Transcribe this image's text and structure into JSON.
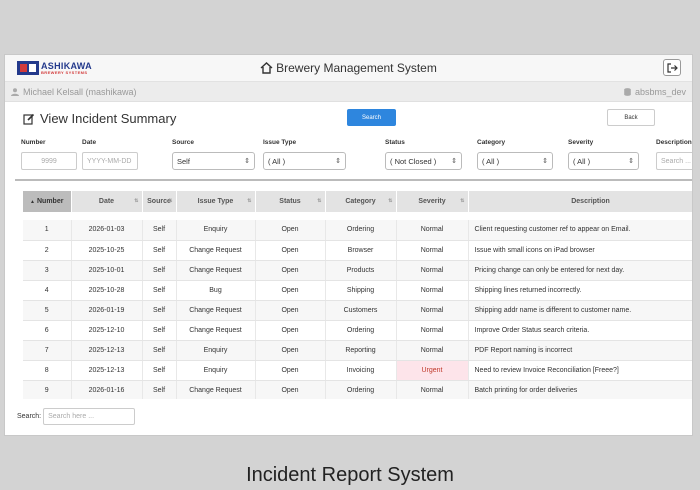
{
  "brand": {
    "name": "ASHIKAWA",
    "sub": "BREWERY SYSTEMS"
  },
  "app": {
    "title": "Brewery Management System"
  },
  "user": {
    "name": "Michael Kelsall (mashikawa)",
    "db": "absbms_dev"
  },
  "page": {
    "title": "View Incident Summary",
    "search_label": "Search",
    "back_label": "Back"
  },
  "filters": {
    "number": {
      "label": "Number",
      "placeholder": "9999"
    },
    "date": {
      "label": "Date",
      "placeholder": "YYYY-MM-DD"
    },
    "source": {
      "label": "Source",
      "value": "Self"
    },
    "issue_type": {
      "label": "Issue Type",
      "value": "( All )"
    },
    "status": {
      "label": "Status",
      "value": "( Not Closed )"
    },
    "category": {
      "label": "Category",
      "value": "( All )"
    },
    "severity": {
      "label": "Severity",
      "value": "( All )"
    },
    "description": {
      "label": "Description",
      "placeholder": "Search ..."
    }
  },
  "table": {
    "columns": [
      "Number",
      "Date",
      "Source",
      "Issue Type",
      "Status",
      "Category",
      "Severity",
      "Description"
    ],
    "rows": [
      [
        "1",
        "2026-01-03",
        "Self",
        "Enquiry",
        "Open",
        "Ordering",
        "Normal",
        "Client requesting customer ref to appear on Email."
      ],
      [
        "2",
        "2025-10-25",
        "Self",
        "Change Request",
        "Open",
        "Browser",
        "Normal",
        "Issue with small icons on iPad browser"
      ],
      [
        "3",
        "2025-10-01",
        "Self",
        "Change Request",
        "Open",
        "Products",
        "Normal",
        "Pricing change can only be entered for next day."
      ],
      [
        "4",
        "2025-10-28",
        "Self",
        "Bug",
        "Open",
        "Shipping",
        "Normal",
        "Shipping lines returned incorrectly."
      ],
      [
        "5",
        "2026-01-19",
        "Self",
        "Change Request",
        "Open",
        "Customers",
        "Normal",
        "Shipping addr name is different to customer name."
      ],
      [
        "6",
        "2025-12-10",
        "Self",
        "Change Request",
        "Open",
        "Ordering",
        "Normal",
        "Improve Order Status search criteria."
      ],
      [
        "7",
        "2025-12-13",
        "Self",
        "Enquiry",
        "Open",
        "Reporting",
        "Normal",
        "PDF Report naming is incorrect"
      ],
      [
        "8",
        "2025-12-13",
        "Self",
        "Enquiry",
        "Open",
        "Invoicing",
        "Urgent",
        "Need to review Invoice Reconciliation [Freee?]"
      ],
      [
        "9",
        "2026-01-16",
        "Self",
        "Change Request",
        "Open",
        "Ordering",
        "Normal",
        "Batch printing for order deliveries"
      ]
    ]
  },
  "footer": {
    "search_label": "Search:",
    "search_placeholder": "Search here ..."
  },
  "caption": "Incident Report System",
  "colors": {
    "brand": "#243a8c",
    "accent": "#2e86de",
    "urgent_bg": "#fde4ea",
    "urgent_text": "#c0392b"
  }
}
